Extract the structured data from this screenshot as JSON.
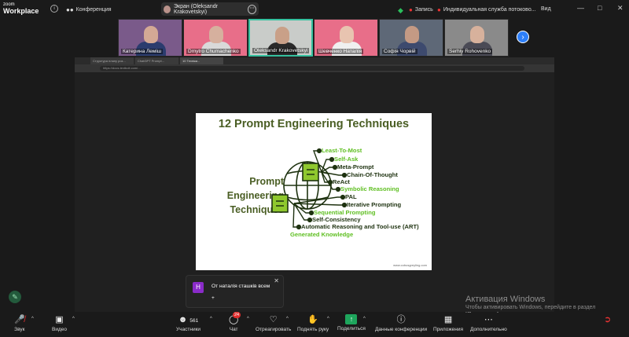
{
  "app": {
    "logo_line1": "zoom",
    "logo_line2": "Workplace"
  },
  "topbar": {
    "meeting_label": "Конференция",
    "screen_share_label": "Экран (Oleksandr Krakovetskyi)",
    "recording_label": "Запись",
    "service_label": "Индивидуальная служба потоково...",
    "view_label": "Вид"
  },
  "participants": [
    {
      "name": "Катерина Леміш",
      "bg": "#7a5a8a",
      "skin": "#d4a995",
      "shirt": "#2b3c6e"
    },
    {
      "name": "Dmytro Chumachenko",
      "bg": "#e86e89",
      "skin": "#d6b09e",
      "shirt": "#d9d9d9"
    },
    {
      "name": "Oleksandr Krakovetskyi",
      "bg": "#c9ccc9",
      "skin": "#c9a088",
      "shirt": "#2a2a2a"
    },
    {
      "name": "Шевченко Наталія",
      "bg": "#e86e89",
      "skin": "#e8c4b0",
      "shirt": "#f0f0f0"
    },
    {
      "name": "Софія Чорвій",
      "bg": "#5e6877",
      "skin": "#c49a84",
      "shirt": "#3d4a6e"
    },
    {
      "name": "Serhiy Rohovenko",
      "bg": "#8a8a8a",
      "skin": "#d7b19c",
      "shirt": "#4a4a55"
    }
  ],
  "browser": {
    "tabs": [
      "Структура плану роз...",
      "ChatGPT Prompt...",
      "10 Техніки..."
    ],
    "url": "https://docs.textbolt.com/..."
  },
  "slide": {
    "title": "12 Prompt Engineering Techniques",
    "label_lines": [
      "Prompt",
      "Engineering",
      "Techniques"
    ],
    "techniques": [
      {
        "label": "Least-To-Most",
        "color": "green"
      },
      {
        "label": "Self-Ask",
        "color": "green"
      },
      {
        "label": "Meta-Prompt",
        "color": "dark"
      },
      {
        "label": "Chain-Of-Thought",
        "color": "dark"
      },
      {
        "label": "ReAct",
        "color": "dark"
      },
      {
        "label": "Symbolic Reasoning",
        "color": "green"
      },
      {
        "label": "PAL",
        "color": "dark"
      },
      {
        "label": "Iterative Prompting",
        "color": "dark"
      },
      {
        "label": "Sequential Prompting",
        "color": "green"
      },
      {
        "label": "Self-Consistency",
        "color": "dark"
      },
      {
        "label": "Automatic Reasoning and Tool-use (ART)",
        "color": "dark"
      },
      {
        "label": "Generated Knowledge",
        "color": "green"
      }
    ],
    "source": "www.cobusgreyling.com"
  },
  "notification": {
    "avatar_letter": "Н",
    "message": "От наталія сташків всем",
    "body": "+"
  },
  "watermark": {
    "title": "Активация Windows",
    "subtitle": "Чтобы активировать Windows, перейдите в раздел \"Параметры\"."
  },
  "bottom_bar": {
    "audio": "Звук",
    "video": "Видео",
    "participants": "Участники",
    "participants_count": "561",
    "chat": "Чат",
    "chat_badge": "24",
    "reactions": "Отреагировать",
    "raise_hand": "Поднять руку",
    "share": "Поделиться",
    "conference_data": "Данные конференции",
    "apps": "Приложения",
    "more": "Дополнительно"
  },
  "colors": {
    "green": "#5fbf22",
    "dark": "#1e3210",
    "accent": "#2d7ff9",
    "active_border": "#36c2a0"
  }
}
